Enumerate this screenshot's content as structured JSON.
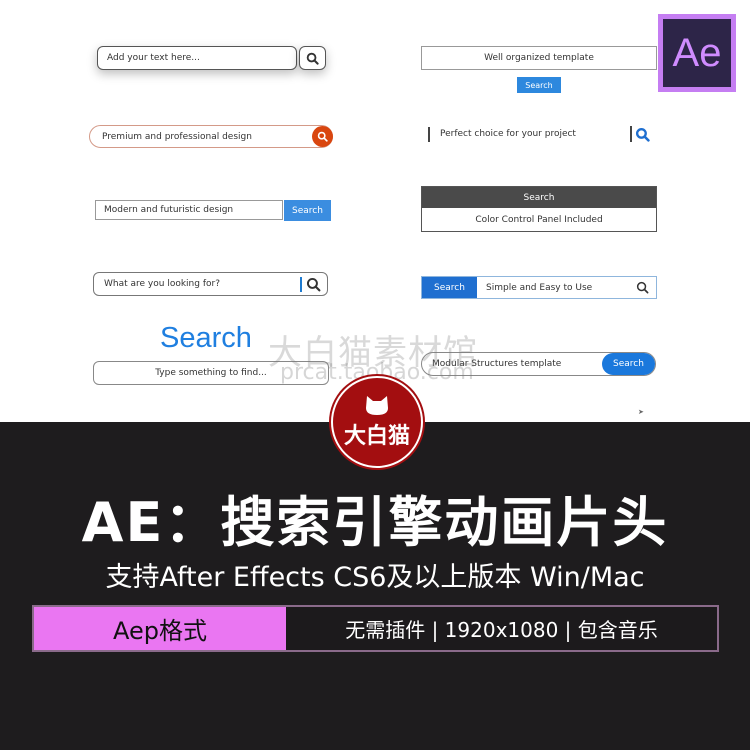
{
  "left_column": [
    {
      "text": "Add your text here...",
      "button": ""
    },
    {
      "text": "Premium and professional design",
      "button": ""
    },
    {
      "text": "Modern and futuristic design",
      "button": "Search"
    },
    {
      "text": "What are you looking for?",
      "button": ""
    },
    {
      "heading": "Search",
      "text": "Type something to find..."
    }
  ],
  "right_column": [
    {
      "text": "Well organized template",
      "button": "Search"
    },
    {
      "text": "Perfect choice for your project"
    },
    {
      "header": "Search",
      "text": "Color Control Panel Included"
    },
    {
      "button": "Search",
      "text": "Simple and Easy to Use"
    },
    {
      "text": "Modular Structures template",
      "button": "Search"
    }
  ],
  "ae_logo": "Ae",
  "watermark": {
    "line1": "大白猫素材馆",
    "line2": "prcat.taobao.com"
  },
  "badge": {
    "text": "大白猫"
  },
  "title": "AE：搜索引擎动画片头",
  "subtitle": "支持After Effects CS6及以上版本 Win/Mac",
  "strip": {
    "left": "Aep格式",
    "right": "无需插件 | 1920x1080 | 包含音乐"
  },
  "colors": {
    "accent_purple": "#ea76f2",
    "ae_purple": "#c57ef2",
    "badge_red": "#a30e10",
    "search_blue": "#1f7fe0"
  }
}
